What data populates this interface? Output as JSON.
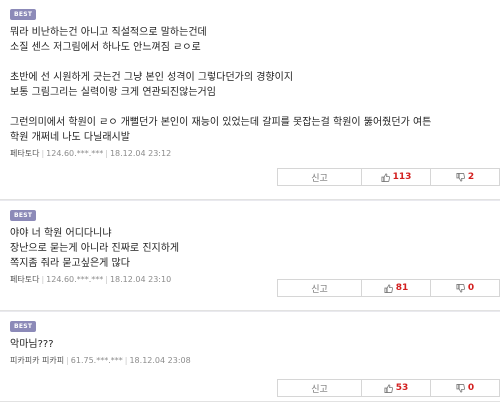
{
  "badge_label": "BEST",
  "comments": [
    {
      "lines": [
        "뭐라 비난하는건 아니고 직설적으로 말하는건데",
        "소질 센스 저그림에서 하나도 안느껴짐 ㄹㅇ로",
        "",
        "초반에 선 시원하게 긋는건 그냥 본인 성격이 그렇다던가의 경향이지",
        "보통 그림그리는 실력이랑 크게 연관되진않는거임",
        "",
        "그런의미에서 학원이 ㄹㅇ 개뻘던가 본인이 재능이 있었는데 갈피를 못잡는걸 학원이 뚫어줬던가 여튼",
        "학원 개쩌네 나도 다닐래시발"
      ],
      "nick": "페타토다",
      "ip": "124.60.***.***",
      "datetime": "18.12.04 23:12",
      "report_label": "신고",
      "up_count": "113",
      "down_count": "2"
    },
    {
      "lines": [
        "야야 너 학원 어디다니냐",
        "장난으로 묻는게 아니라 진짜로 진지하게",
        "쪽지좀 줘라 묻고싶은게 많다"
      ],
      "nick": "페타토다",
      "ip": "124.60.***.***",
      "datetime": "18.12.04 23:10",
      "report_label": "신고",
      "up_count": "81",
      "down_count": "0"
    },
    {
      "lines": [
        "악마님???"
      ],
      "nick": "피카피카 피카피",
      "ip": "61.75.***.***",
      "datetime": "18.12.04 23:08",
      "report_label": "신고",
      "up_count": "53",
      "down_count": "0"
    }
  ],
  "colors": {
    "badge": "#8c8ab8",
    "vote_number": "#d32020",
    "page_background": "#e9e9ee"
  },
  "icons": {
    "up": "thumbs-up-icon",
    "down": "thumbs-down-icon"
  }
}
